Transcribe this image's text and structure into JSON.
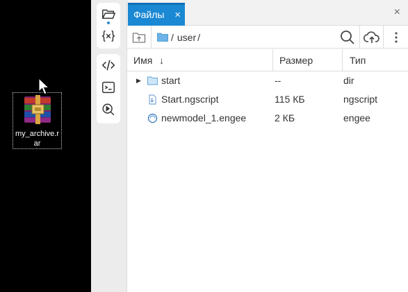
{
  "desktop": {
    "icon_label": "my_archive.rar",
    "icon_name": "winrar-archive-icon"
  },
  "panel": {
    "tab_label": "Файлы",
    "tab_close": "×",
    "panel_close": "×",
    "path_separator_start": "/",
    "path_segment": "user",
    "path_separator_end": "/",
    "accent_color": "#1a88d3"
  },
  "columns": {
    "name": "Имя",
    "sort_arrow": "↓",
    "size": "Размер",
    "type": "Тип"
  },
  "files": [
    {
      "name": "start",
      "size": "--",
      "type": "dir",
      "icon": "folder-icon",
      "expandable": true
    },
    {
      "name": "Start.ngscript",
      "size": "115 КБ",
      "type": "ngscript",
      "icon": "script-file-icon",
      "expandable": false
    },
    {
      "name": "newmodel_1.engee",
      "size": "2 КБ",
      "type": "engee",
      "icon": "engee-model-icon",
      "expandable": false
    }
  ]
}
